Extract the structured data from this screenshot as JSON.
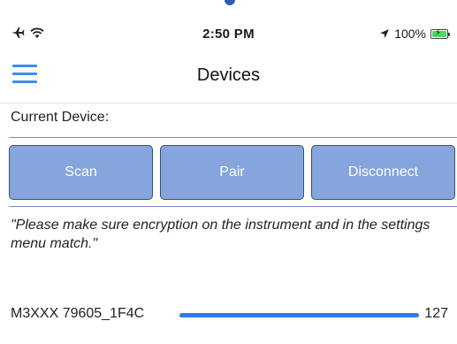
{
  "status_bar": {
    "time": "2:50 PM",
    "battery_text": "100%",
    "airplane_icon": "airplane-icon",
    "wifi_icon": "wifi-icon",
    "location_icon": "location-arrow-icon",
    "battery_icon": "battery-charging-icon",
    "battery_level": 1.0
  },
  "nav": {
    "title": "Devices",
    "menu_icon": "hamburger-menu-icon",
    "accent_color": "#3a8ef0"
  },
  "current_device": {
    "label": "Current Device:"
  },
  "actions": {
    "scan_label": "Scan",
    "pair_label": "Pair",
    "disconnect_label": "Disconnect",
    "button_color": "#86a5dc"
  },
  "notice": {
    "text": "\"Please make sure encryption on the instrument and in the settings menu match.\""
  },
  "devices": [
    {
      "name": "M3XXX 79605_1F4C",
      "signal_value": "127",
      "signal_fraction": 1.0
    }
  ]
}
